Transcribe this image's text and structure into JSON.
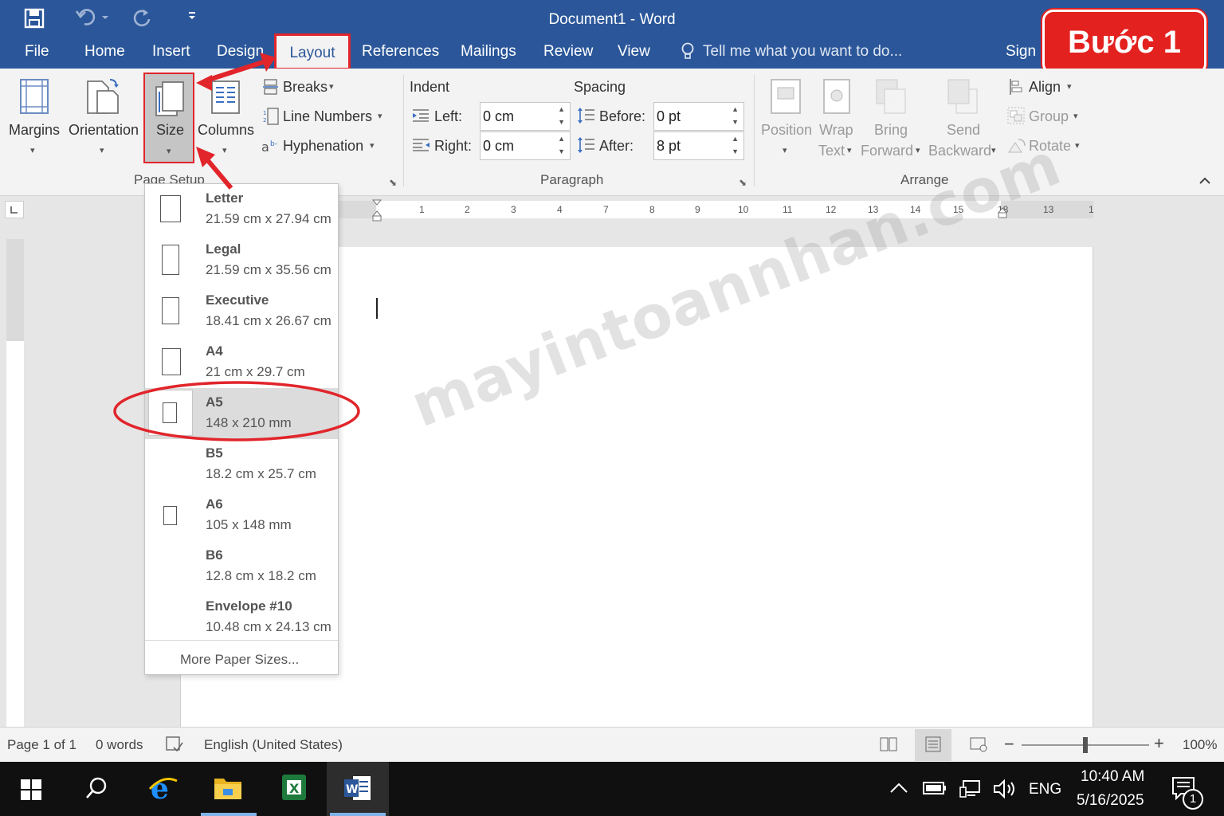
{
  "window": {
    "title": "Document1  -  Word"
  },
  "tabs": [
    "File",
    "Home",
    "Insert",
    "Design",
    "Layout",
    "References",
    "Mailings",
    "Review",
    "View"
  ],
  "active_tab": "Layout",
  "tell_me": "Tell me what you want to do...",
  "sign_in": "Sign in",
  "step_badge": "Bước 1",
  "ribbon": {
    "page_setup": {
      "margins": "Margins",
      "orientation": "Orientation",
      "size": "Size",
      "columns": "Columns",
      "breaks": "Breaks",
      "line_numbers": "Line Numbers",
      "hyphenation": "Hyphenation",
      "group_label": "Page Setup"
    },
    "paragraph": {
      "indent_title": "Indent",
      "spacing_title": "Spacing",
      "left_label": "Left:",
      "left_value": "0 cm",
      "right_label": "Right:",
      "right_value": "0 cm",
      "before_label": "Before:",
      "before_value": "0 pt",
      "after_label": "After:",
      "after_value": "8 pt",
      "group_label": "Paragraph"
    },
    "arrange": {
      "position": "Position",
      "wrap_1": "Wrap",
      "wrap_2": "Text",
      "bring_1": "Bring",
      "bring_2": "Forward",
      "send_1": "Send",
      "send_2": "Backward",
      "align": "Align",
      "group": "Group",
      "rotate": "Rotate",
      "group_label": "Arrange"
    }
  },
  "ruler_numbers": [
    "1",
    "2",
    "3",
    "4",
    "7",
    "8",
    "9",
    "10",
    "11",
    "12",
    "13",
    "14",
    "15",
    "18",
    "13",
    "1"
  ],
  "size_menu": {
    "items": [
      {
        "name": "Letter",
        "dims": "21.59 cm x 27.94 cm"
      },
      {
        "name": "Legal",
        "dims": "21.59 cm x 35.56 cm"
      },
      {
        "name": "Executive",
        "dims": "18.41 cm x 26.67 cm"
      },
      {
        "name": "A4",
        "dims": "21 cm x 29.7 cm"
      },
      {
        "name": "A5",
        "dims": "148 x 210 mm"
      },
      {
        "name": "B5",
        "dims": "18.2 cm x 25.7 cm"
      },
      {
        "name": "A6",
        "dims": "105 x 148 mm"
      },
      {
        "name": "B6",
        "dims": "12.8 cm x 18.2 cm"
      },
      {
        "name": "Envelope #10",
        "dims": "10.48 cm x 24.13 cm"
      }
    ],
    "selected": "A5",
    "more": "More Paper Sizes..."
  },
  "watermark": "mayintoannhan.com",
  "status": {
    "page": "Page 1 of 1",
    "words": "0 words",
    "language": "English (United States)",
    "zoom": "100%",
    "zoom_level": 0.5
  },
  "taskbar": {
    "lang": "ENG",
    "time": "10:40 AM",
    "date": "5/16/2025",
    "notifications": "1"
  },
  "colors": {
    "word_blue": "#2b579a",
    "highlight_red": "#e1252b",
    "taskbar": "#101010"
  }
}
